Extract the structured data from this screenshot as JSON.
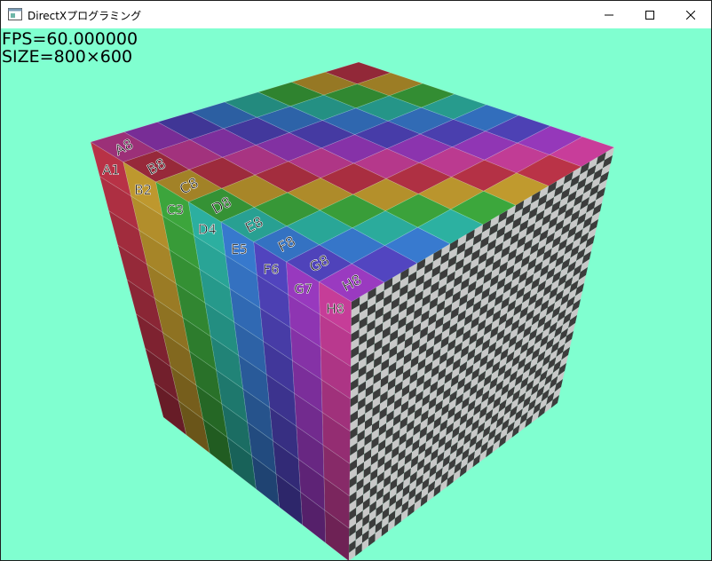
{
  "window": {
    "title": "DirectXプログラミング",
    "icon": "window-app-icon",
    "controls": [
      "minimize-icon",
      "maximize-icon",
      "close-icon"
    ]
  },
  "hud": {
    "fps": "FPS=60.000000",
    "size": "SIZE=800×600"
  },
  "scene": {
    "background": "#80ffd0",
    "cube": {
      "grid": 8,
      "columns": [
        "A",
        "B",
        "C",
        "D",
        "E",
        "F",
        "G",
        "H"
      ],
      "top_face_labels": [
        "H8",
        "G8",
        "F8",
        "E8",
        "D8",
        "C8",
        "B8",
        "A8"
      ],
      "checker_face_colors": [
        "#3c3c3c",
        "#c8c8c8"
      ]
    }
  }
}
